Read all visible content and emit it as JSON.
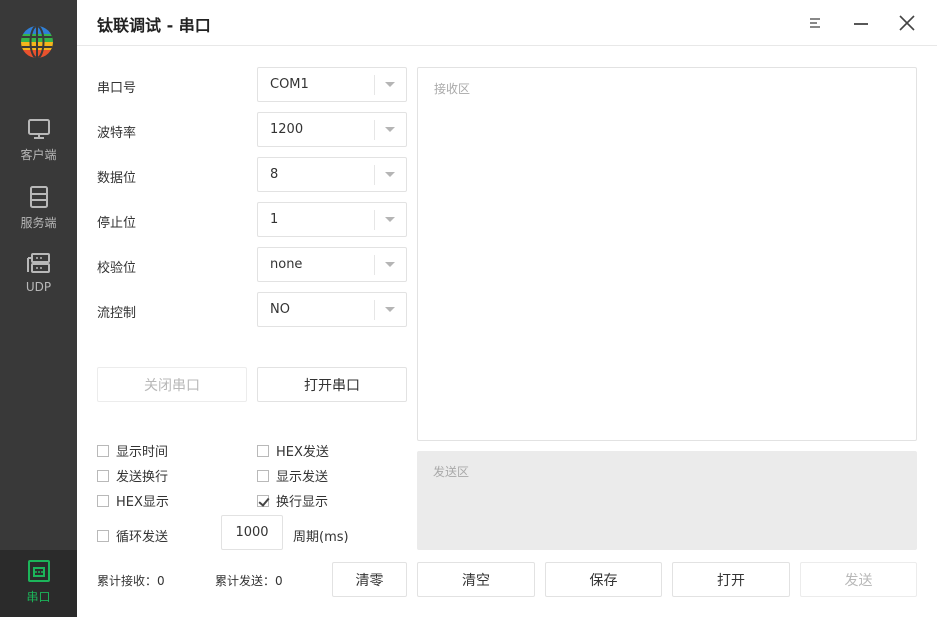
{
  "app": {
    "title": "钛联调试 - 串口"
  },
  "sidebar": {
    "items": [
      {
        "label": "客户端",
        "icon": "monitor-icon",
        "active": false
      },
      {
        "label": "服务端",
        "icon": "server-icon",
        "active": false
      },
      {
        "label": "UDP",
        "icon": "udp-network-icon",
        "active": false
      },
      {
        "label": "串口",
        "icon": "serial-port-icon",
        "active": true
      }
    ]
  },
  "form": {
    "port": {
      "label": "串口号",
      "value": "COM1"
    },
    "baud": {
      "label": "波特率",
      "value": "1200"
    },
    "databits": {
      "label": "数据位",
      "value": "8"
    },
    "stopbits": {
      "label": "停止位",
      "value": "1"
    },
    "parity": {
      "label": "校验位",
      "value": "none"
    },
    "flow": {
      "label": "流控制",
      "value": "NO"
    }
  },
  "buttons": {
    "close_port": "关闭串口",
    "open_port": "打开串口",
    "reset": "清零",
    "clear": "清空",
    "save": "保存",
    "open": "打开",
    "send": "发送"
  },
  "options": {
    "show_time": {
      "label": "显示时间",
      "checked": false
    },
    "hex_send": {
      "label": "HEX发送",
      "checked": false
    },
    "send_newline": {
      "label": "发送换行",
      "checked": false
    },
    "show_send": {
      "label": "显示发送",
      "checked": false
    },
    "hex_display": {
      "label": "HEX显示",
      "checked": false
    },
    "newline_display": {
      "label": "换行显示",
      "checked": true
    },
    "loop_send": {
      "label": "循环发送",
      "checked": false
    }
  },
  "period": {
    "value": "1000",
    "label": "周期(ms)"
  },
  "stats": {
    "received": "累计接收：0",
    "sent": "累计发送：0"
  },
  "areas": {
    "receive_placeholder": "接收区",
    "send_placeholder": "发送区"
  },
  "colors": {
    "sidebar": "#393939",
    "accent": "#1cb55a"
  }
}
